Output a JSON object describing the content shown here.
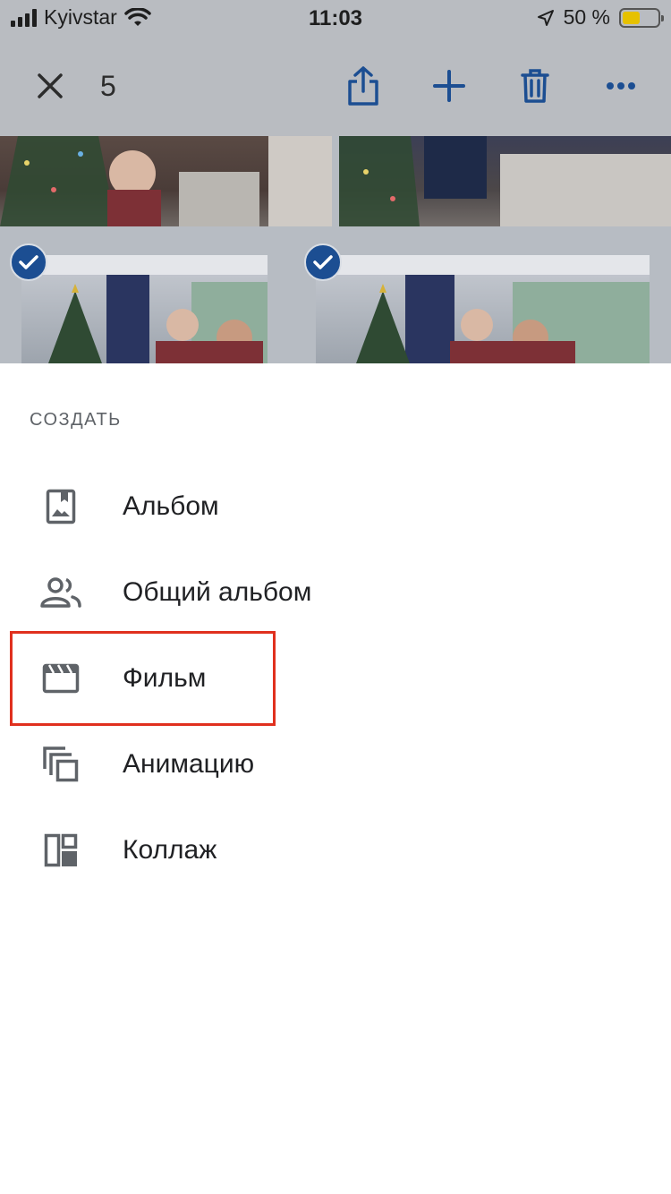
{
  "status_bar": {
    "carrier": "Kyivstar",
    "time": "11:03",
    "battery": "50 %",
    "battery_level": 0.5,
    "icons": [
      "signal-icon",
      "wifi-icon",
      "location-arrow-icon",
      "battery-icon"
    ]
  },
  "toolbar": {
    "selected_count": "5",
    "icons": [
      "close-icon",
      "share-icon",
      "add-icon",
      "delete-icon",
      "more-icon"
    ]
  },
  "sheet": {
    "header": "СОЗДАТЬ",
    "items": [
      {
        "label": "Альбом",
        "icon": "album-icon"
      },
      {
        "label": "Общий альбом",
        "icon": "shared-album-icon"
      },
      {
        "label": "Фильм",
        "icon": "movie-icon"
      },
      {
        "label": "Анимацию",
        "icon": "animation-icon"
      },
      {
        "label": "Коллаж",
        "icon": "collage-icon"
      }
    ]
  },
  "colors": {
    "accent": "#1c4e92",
    "highlight": "#e0301e",
    "icon": "#5f6368",
    "text": "#202124"
  }
}
